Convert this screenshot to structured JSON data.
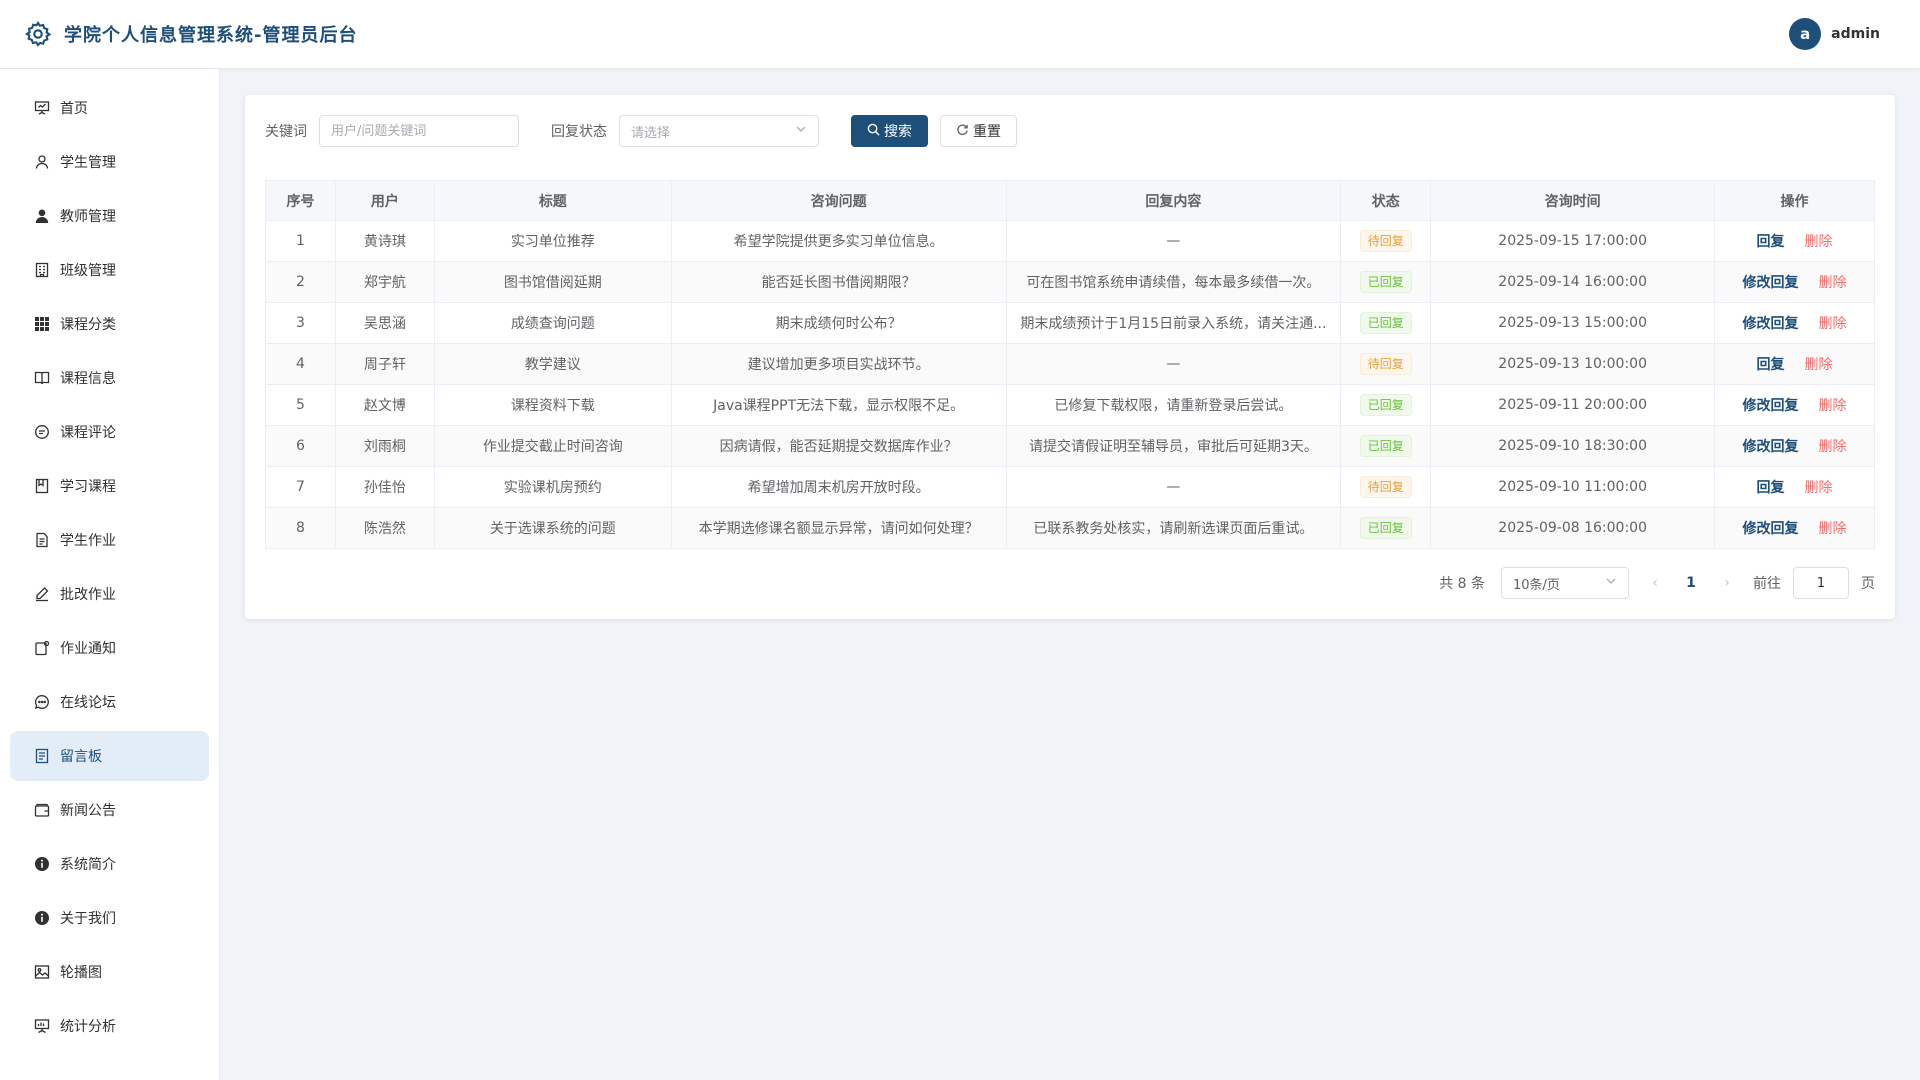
{
  "header": {
    "title": "学院个人信息管理系统-管理员后台",
    "avatar_letter": "a",
    "username": "admin",
    "brand_color": "#1d4f7a"
  },
  "sidebar": {
    "items": [
      {
        "label": "首页",
        "icon": "presentation-icon"
      },
      {
        "label": "学生管理",
        "icon": "user-icon"
      },
      {
        "label": "教师管理",
        "icon": "user-filled-icon"
      },
      {
        "label": "班级管理",
        "icon": "office-building-icon"
      },
      {
        "label": "课程分类",
        "icon": "grid-icon"
      },
      {
        "label": "课程信息",
        "icon": "book-icon"
      },
      {
        "label": "课程评论",
        "icon": "chat-icon"
      },
      {
        "label": "学习课程",
        "icon": "notebook-icon"
      },
      {
        "label": "学生作业",
        "icon": "document-icon"
      },
      {
        "label": "批改作业",
        "icon": "edit-pen-icon"
      },
      {
        "label": "作业通知",
        "icon": "notification-icon"
      },
      {
        "label": "在线论坛",
        "icon": "chat-dots-icon"
      },
      {
        "label": "留言板",
        "icon": "tickets-icon",
        "active": true
      },
      {
        "label": "新闻公告",
        "icon": "wallet-icon"
      },
      {
        "label": "系统简介",
        "icon": "info-filled-icon"
      },
      {
        "label": "关于我们",
        "icon": "info-filled-icon"
      },
      {
        "label": "轮播图",
        "icon": "picture-icon"
      },
      {
        "label": "统计分析",
        "icon": "data-board-icon"
      }
    ]
  },
  "filters": {
    "keyword_label": "关键词",
    "keyword_placeholder": "用户/问题关键词",
    "status_label": "回复状态",
    "status_placeholder": "请选择",
    "search_label": "搜索",
    "reset_label": "重置"
  },
  "table": {
    "columns": [
      "序号",
      "用户",
      "标题",
      "咨询问题",
      "回复内容",
      "状态",
      "咨询时间",
      "操作"
    ],
    "rows": [
      {
        "no": "1",
        "user": "黄诗琪",
        "title": "实习单位推荐",
        "question": "希望学院提供更多实习单位信息。",
        "reply": "—",
        "status": "待回复",
        "replied": false,
        "time": "2025-09-15 17:00:00",
        "action": "回复",
        "delete": "删除"
      },
      {
        "no": "2",
        "user": "郑宇航",
        "title": "图书馆借阅延期",
        "question": "能否延长图书借阅期限？",
        "reply": "可在图书馆系统申请续借，每本最多续借一次。",
        "status": "已回复",
        "replied": true,
        "time": "2025-09-14 16:00:00",
        "action": "修改回复",
        "delete": "删除"
      },
      {
        "no": "3",
        "user": "吴思涵",
        "title": "成绩查询问题",
        "question": "期末成绩何时公布？",
        "reply": "期末成绩预计于1月15日前录入系统，请关注通...",
        "status": "已回复",
        "replied": true,
        "time": "2025-09-13 15:00:00",
        "action": "修改回复",
        "delete": "删除"
      },
      {
        "no": "4",
        "user": "周子轩",
        "title": "教学建议",
        "question": "建议增加更多项目实战环节。",
        "reply": "—",
        "status": "待回复",
        "replied": false,
        "time": "2025-09-13 10:00:00",
        "action": "回复",
        "delete": "删除"
      },
      {
        "no": "5",
        "user": "赵文博",
        "title": "课程资料下载",
        "question": "Java课程PPT无法下载，显示权限不足。",
        "reply": "已修复下载权限，请重新登录后尝试。",
        "status": "已回复",
        "replied": true,
        "time": "2025-09-11 20:00:00",
        "action": "修改回复",
        "delete": "删除"
      },
      {
        "no": "6",
        "user": "刘雨桐",
        "title": "作业提交截止时间咨询",
        "question": "因病请假，能否延期提交数据库作业？",
        "reply": "请提交请假证明至辅导员，审批后可延期3天。",
        "status": "已回复",
        "replied": true,
        "time": "2025-09-10 18:30:00",
        "action": "修改回复",
        "delete": "删除"
      },
      {
        "no": "7",
        "user": "孙佳怡",
        "title": "实验课机房预约",
        "question": "希望增加周末机房开放时段。",
        "reply": "—",
        "status": "待回复",
        "replied": false,
        "time": "2025-09-10 11:00:00",
        "action": "回复",
        "delete": "删除"
      },
      {
        "no": "8",
        "user": "陈浩然",
        "title": "关于选课系统的问题",
        "question": "本学期选修课名额显示异常，请问如何处理？",
        "reply": "已联系教务处核实，请刷新选课页面后重试。",
        "status": "已回复",
        "replied": true,
        "time": "2025-09-08 16:00:00",
        "action": "修改回复",
        "delete": "删除"
      }
    ]
  },
  "pagination": {
    "total_text": "共 8 条",
    "page_size": "10条/页",
    "current_page": "1",
    "goto_label": "前往",
    "goto_value": "1",
    "page_suffix": "页"
  }
}
